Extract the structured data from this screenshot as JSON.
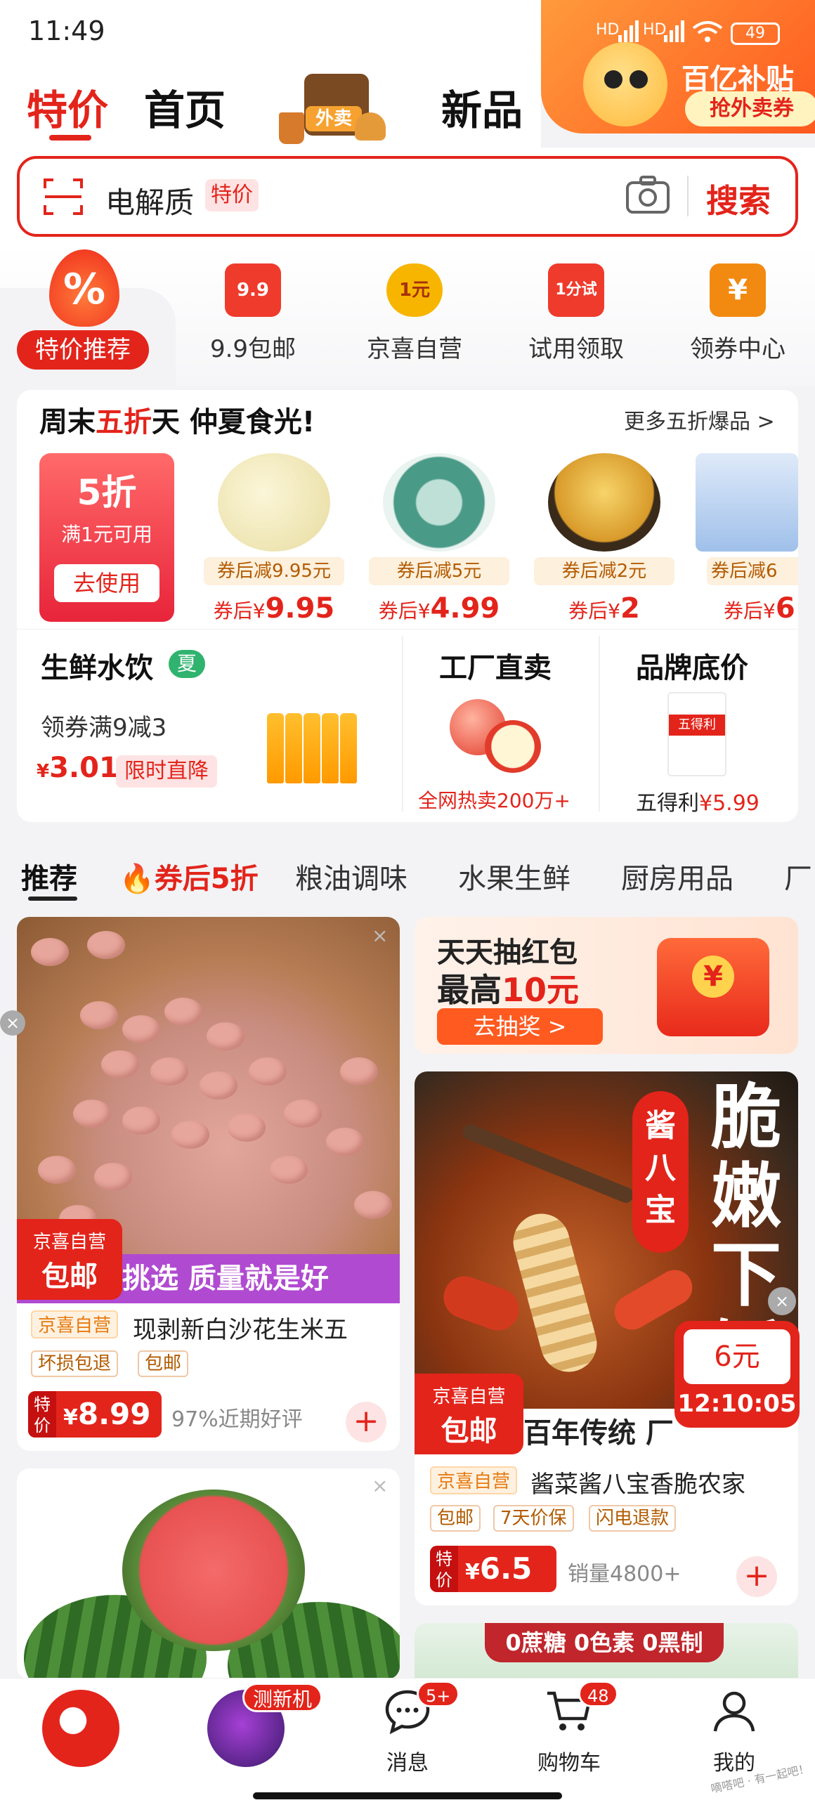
{
  "status": {
    "time": "11:49",
    "battery": "49",
    "signal1": "HD",
    "signal2": "HD"
  },
  "promo": {
    "title": "百亿补贴",
    "button": "抢外卖券"
  },
  "tabs": {
    "tejia": "特价",
    "home": "首页",
    "waimai": "外卖",
    "new": "新品"
  },
  "search": {
    "text": "电解质",
    "tag": "特价",
    "button": "搜索"
  },
  "quick": {
    "selected": "特价推荐",
    "selected_icon": "%",
    "items": [
      {
        "icon": "9.9",
        "label": "9.9包邮",
        "color": "#ef3b2c"
      },
      {
        "icon": "1元",
        "label": "京喜自营",
        "color": "#f7b500"
      },
      {
        "icon": "1分试",
        "label": "试用领取",
        "color": "#ef3b2c"
      },
      {
        "icon": "¥",
        "label": "领券中心",
        "color": "#f28a12"
      }
    ]
  },
  "weekend": {
    "title_a": "周末",
    "title_b": "五折",
    "title_c": "天 仲夏食光!",
    "more": "更多五折爆品 >",
    "coupon": {
      "discount": "5折",
      "condition": "满1元可用",
      "use": "去使用"
    },
    "deals": [
      {
        "tag": "券后减9.95元",
        "price_prefix": "券后¥",
        "price": "9.95",
        "color": "#f3ecc8"
      },
      {
        "tag": "券后减5元",
        "price_prefix": "券后¥",
        "price": "4.99",
        "color": "#4a9a88"
      },
      {
        "tag": "券后减2元",
        "price_prefix": "券后¥",
        "price": "2",
        "color": "#f1c04a"
      },
      {
        "tag": "券后减6",
        "price_prefix": "券后¥",
        "price": "6",
        "color": "#a9c8f0"
      }
    ]
  },
  "panels": {
    "fresh": {
      "title": "生鲜水饮",
      "badge": "夏",
      "sub": "领券满9减3",
      "price_symbol": "¥",
      "price": "3.01",
      "tag": "限时直降"
    },
    "factory": {
      "title": "工厂直卖",
      "sub": "全网热卖200万+"
    },
    "brand": {
      "title": "品牌底价",
      "bag_label": "五得利",
      "sub_name": "五得利",
      "sub_price": "¥5.99"
    }
  },
  "feed_tabs": [
    "推荐",
    "券后5折",
    "粮油调味",
    "水果生鲜",
    "厨房用品",
    "厂"
  ],
  "cards": {
    "peanut": {
      "ship_a": "京喜自营",
      "ship_b": "包邮",
      "banner": "挑选 质量就是好",
      "shop": "京喜自营",
      "title": "现剥新白沙花生米五",
      "tags": [
        "坏损包退",
        "包邮"
      ],
      "price_label": "特价",
      "price_symbol": "¥",
      "price": "8.99",
      "info": "97%近期好评",
      "add": "+"
    },
    "hongbao": {
      "line1": "天天抽红包",
      "line2a": "最高",
      "line2b": "10元",
      "button": "去抽奖 >",
      "gift_symbol": "¥"
    },
    "jiang": {
      "stamp": "酱八宝",
      "vertical": "脆嫩下饭",
      "ship_a": "京喜自营",
      "ship_b": "包邮",
      "banner": "百年传统 厂",
      "flash_price": "6元",
      "flash_time": "12:10:05",
      "shop": "京喜自营",
      "title": "酱菜酱八宝香脆农家",
      "tags": [
        "包邮",
        "7天价保",
        "闪电退款"
      ],
      "price_label": "特价",
      "price_symbol": "¥",
      "price": "6.5",
      "info": "销量4800+",
      "add": "+"
    },
    "sugar": {
      "banner": "0蔗糖 0色素 0黑制"
    }
  },
  "nav": {
    "new_badge": "测新机",
    "messages": {
      "label": "消息",
      "badge": "5+"
    },
    "cart": {
      "label": "购物车",
      "badge": "48"
    },
    "me": {
      "label": "我的"
    }
  },
  "watermark": "嘀嗒吧 · 有一起吧！"
}
